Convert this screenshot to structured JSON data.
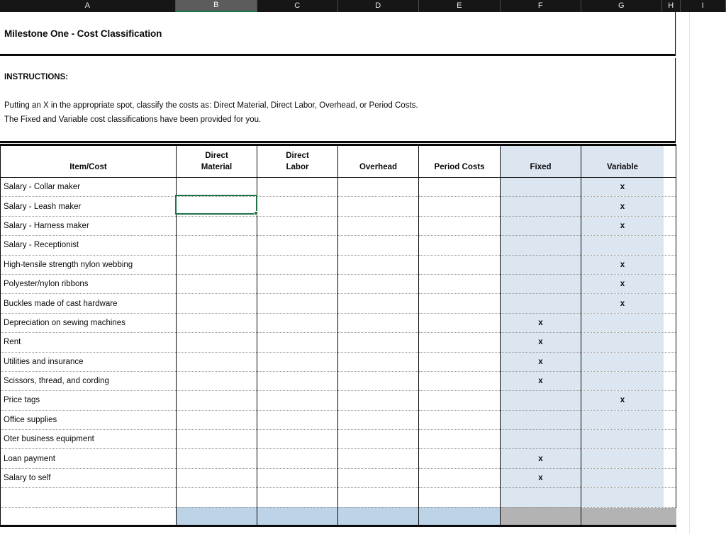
{
  "spreadsheet": {
    "column_letters": [
      "A",
      "B",
      "C",
      "D",
      "E",
      "F",
      "G",
      "H",
      "I"
    ],
    "selected_column": "B",
    "selected_cell_ref": "B",
    "colors": {
      "header_bar": "#161616",
      "selected_column": "#5c5c5c",
      "selection_green": "#217346",
      "light_blue_fill": "#dce6f1",
      "medium_blue_fill": "#bdd3e8",
      "grey_fill": "#b3b3b3",
      "gridline": "#e2e6ea"
    }
  },
  "title": "Milestone One - Cost Classification",
  "instructions": {
    "heading": "INSTRUCTIONS:",
    "line1": "Putting an X in the appropriate spot, classify the costs as:  Direct Material, Direct Labor, Overhead, or Period Costs.",
    "line2": "The Fixed and Variable cost classifications have been provided for you."
  },
  "table": {
    "headers": {
      "item": "Item/Cost",
      "direct_material_l1": "Direct",
      "direct_material_l2": "Material",
      "direct_labor_l1": "Direct",
      "direct_labor_l2": "Labor",
      "overhead": "Overhead",
      "period_costs": "Period Costs",
      "fixed": "Fixed",
      "variable": "Variable"
    },
    "mark": "x",
    "rows": [
      {
        "item": "Salary - Collar maker",
        "direct_material": "",
        "direct_labor": "",
        "overhead": "",
        "period_costs": "",
        "fixed": "",
        "variable": "x"
      },
      {
        "item": "Salary - Leash maker",
        "direct_material": "",
        "direct_labor": "",
        "overhead": "",
        "period_costs": "",
        "fixed": "",
        "variable": "x"
      },
      {
        "item": "Salary - Harness maker",
        "direct_material": "",
        "direct_labor": "",
        "overhead": "",
        "period_costs": "",
        "fixed": "",
        "variable": "x"
      },
      {
        "item": "Salary - Receptionist",
        "direct_material": "",
        "direct_labor": "",
        "overhead": "",
        "period_costs": "",
        "fixed": "",
        "variable": ""
      },
      {
        "item": "High-tensile strength nylon webbing",
        "direct_material": "",
        "direct_labor": "",
        "overhead": "",
        "period_costs": "",
        "fixed": "",
        "variable": "x"
      },
      {
        "item": "Polyester/nylon ribbons",
        "direct_material": "",
        "direct_labor": "",
        "overhead": "",
        "period_costs": "",
        "fixed": "",
        "variable": "x"
      },
      {
        "item": "Buckles made of cast hardware",
        "direct_material": "",
        "direct_labor": "",
        "overhead": "",
        "period_costs": "",
        "fixed": "",
        "variable": "x"
      },
      {
        "item": "Depreciation on sewing machines",
        "direct_material": "",
        "direct_labor": "",
        "overhead": "",
        "period_costs": "",
        "fixed": "x",
        "variable": ""
      },
      {
        "item": "Rent",
        "direct_material": "",
        "direct_labor": "",
        "overhead": "",
        "period_costs": "",
        "fixed": "x",
        "variable": ""
      },
      {
        "item": "Utilities and insurance",
        "direct_material": "",
        "direct_labor": "",
        "overhead": "",
        "period_costs": "",
        "fixed": "x",
        "variable": ""
      },
      {
        "item": "Scissors, thread, and cording",
        "direct_material": "",
        "direct_labor": "",
        "overhead": "",
        "period_costs": "",
        "fixed": "x",
        "variable": ""
      },
      {
        "item": "Price tags",
        "direct_material": "",
        "direct_labor": "",
        "overhead": "",
        "period_costs": "",
        "fixed": "",
        "variable": "x"
      },
      {
        "item": "Office supplies",
        "direct_material": "",
        "direct_labor": "",
        "overhead": "",
        "period_costs": "",
        "fixed": "",
        "variable": ""
      },
      {
        "item": "Oter business equipment",
        "direct_material": "",
        "direct_labor": "",
        "overhead": "",
        "period_costs": "",
        "fixed": "",
        "variable": ""
      },
      {
        "item": "Loan payment",
        "direct_material": "",
        "direct_labor": "",
        "overhead": "",
        "period_costs": "",
        "fixed": "x",
        "variable": ""
      },
      {
        "item": "Salary to self",
        "direct_material": "",
        "direct_labor": "",
        "overhead": "",
        "period_costs": "",
        "fixed": "x",
        "variable": ""
      }
    ],
    "blank_row": {
      "item": "",
      "direct_material": "",
      "direct_labor": "",
      "overhead": "",
      "period_costs": "",
      "fixed": "",
      "variable": ""
    },
    "total_row": {
      "item": "",
      "direct_material": "",
      "direct_labor": "",
      "overhead": "",
      "period_costs": "",
      "fixed": "",
      "variable": ""
    }
  }
}
